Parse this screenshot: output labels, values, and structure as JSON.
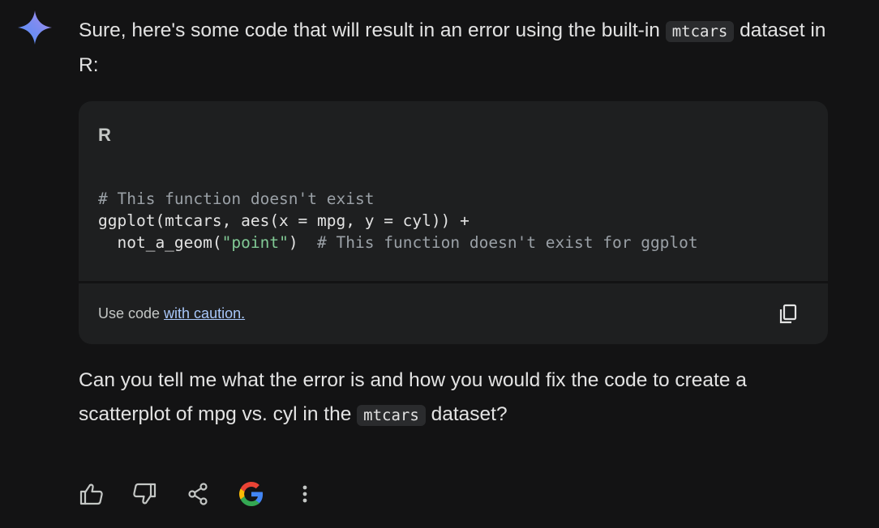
{
  "response": {
    "intro_before": "Sure, here's some code that will result in an error using the built-in ",
    "intro_code": "mtcars",
    "intro_after": " dataset in R:"
  },
  "code_card": {
    "language": "R",
    "lines": {
      "l1_comment": "# This function doesn't exist",
      "l2": "ggplot(mtcars, aes(x = mpg, y = cyl)) +",
      "l3_pre": "  not_a_geom(",
      "l3_str": "\"point\"",
      "l3_post": ")  ",
      "l3_comment": "# This function doesn't exist for ggplot"
    },
    "caution_prefix": "Use code ",
    "caution_link": "with caution."
  },
  "question": {
    "before": "Can you tell me what the error is and how you would fix the code to create a scatterplot of mpg vs. cyl in the ",
    "code": "mtcars",
    "after": " dataset?"
  },
  "actions": {
    "icons": [
      "thumbs-up-icon",
      "thumbs-down-icon",
      "share-icon",
      "google-icon",
      "more-vert-icon"
    ]
  },
  "colors": {
    "background": "#131314",
    "card": "#1e1f20",
    "link": "#a8c7fa",
    "string": "#81c995",
    "comment": "#9aa0a6"
  }
}
